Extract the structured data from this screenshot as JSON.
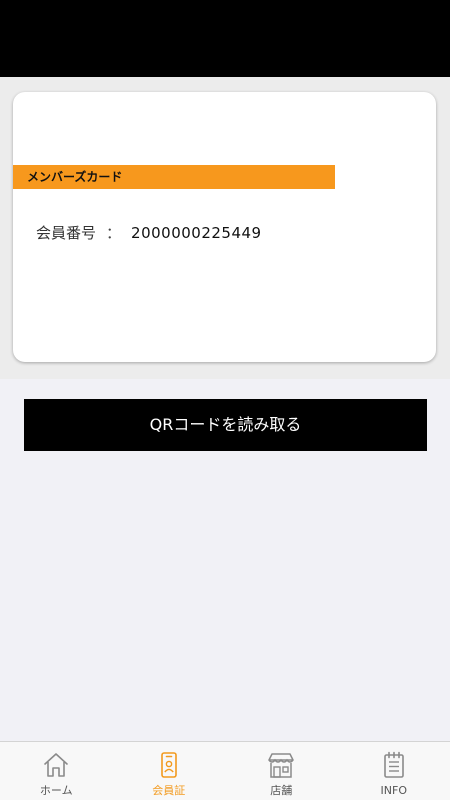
{
  "card": {
    "title": "メンバーズカード",
    "member_label": "会員番号",
    "separator": "：",
    "member_number": "2000000225449"
  },
  "actions": {
    "scan_qr_label": "QRコードを読み取る"
  },
  "tabbar": {
    "items": [
      {
        "label": "ホーム",
        "icon": "home-icon",
        "active": false
      },
      {
        "label": "会員証",
        "icon": "member-card-icon",
        "active": true
      },
      {
        "label": "店舗",
        "icon": "store-icon",
        "active": false
      },
      {
        "label": "INFO",
        "icon": "notepad-icon",
        "active": false
      }
    ]
  },
  "colors": {
    "accent": "#f7981d",
    "active_tab": "#f29a1e",
    "button_bg": "#000000",
    "status_bar": "#000000"
  }
}
